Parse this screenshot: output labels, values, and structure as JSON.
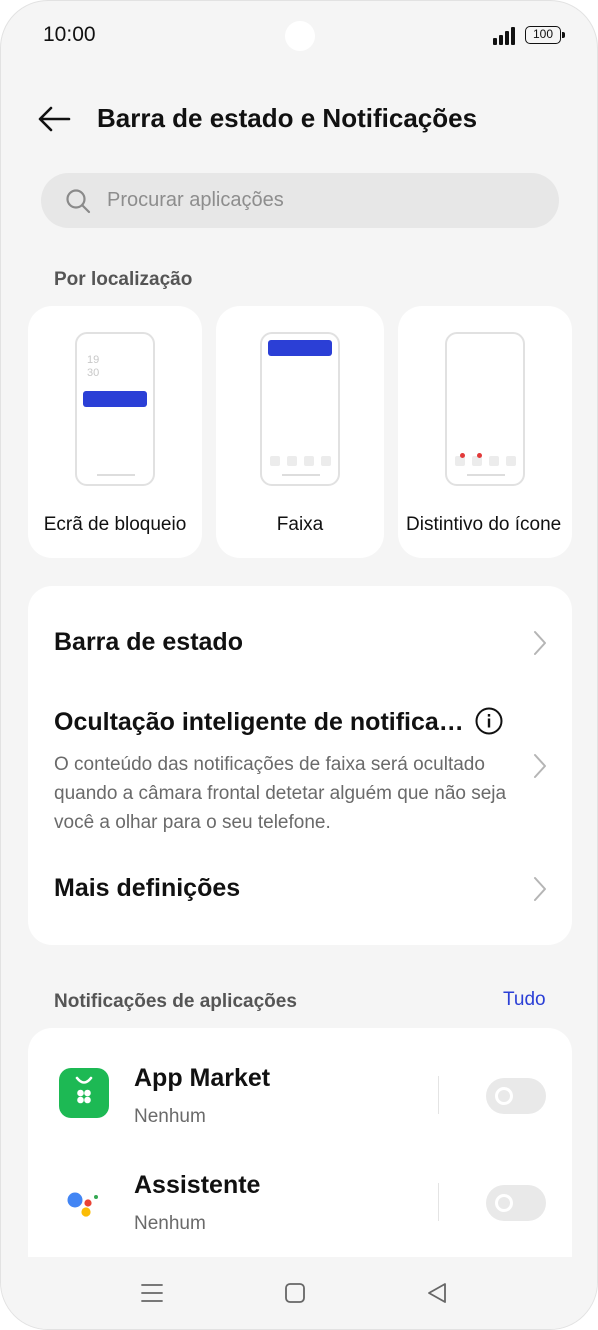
{
  "status_bar": {
    "time": "10:00",
    "battery": "100"
  },
  "header": {
    "title": "Barra de estado e Notificações"
  },
  "search": {
    "placeholder": "Procurar aplicações"
  },
  "location_section": {
    "label": "Por localização",
    "cards": [
      {
        "label": "Ecrã de bloqueio",
        "clock_hour": "19",
        "clock_min": "30"
      },
      {
        "label": "Faixa"
      },
      {
        "label": "Distintivo do ícone"
      }
    ]
  },
  "settings": {
    "status_bar_label": "Barra de estado",
    "smart_hide_title": "Ocultação inteligente de notifica…",
    "smart_hide_desc": "O conteúdo das notificações de faixa será ocultado quando a câmara frontal detetar alguém que não seja você a olhar para o seu telefone.",
    "more_settings_label": "Mais definições"
  },
  "app_notifications": {
    "label": "Notificações de aplicações",
    "all_link": "Tudo",
    "apps": [
      {
        "name": "App Market",
        "status": "Nenhum",
        "enabled": false
      },
      {
        "name": "Assistente",
        "status": "Nenhum",
        "enabled": false
      }
    ]
  },
  "colors": {
    "accent": "#2b3fd6",
    "badge_dot": "#e23a3a",
    "app_market_green": "#1db954"
  },
  "icons": [
    "back-arrow-icon",
    "search-icon",
    "chevron-right-icon",
    "info-icon",
    "app-market-icon",
    "assistant-icon",
    "menu-icon",
    "home-icon",
    "back-triangle-icon"
  ]
}
